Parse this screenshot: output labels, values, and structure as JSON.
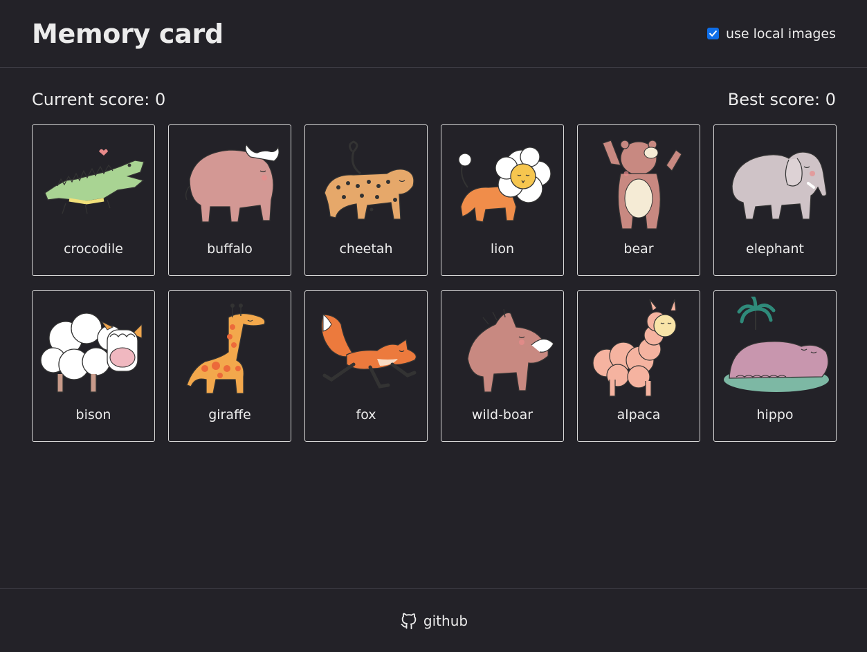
{
  "header": {
    "title": "Memory card",
    "toggle_label": "use local images",
    "toggle_checked": true
  },
  "scores": {
    "current_label": "Current score: 0",
    "best_label": "Best score: 0",
    "current": 0,
    "best": 0
  },
  "cards": [
    {
      "label": "crocodile",
      "art": "crocodile"
    },
    {
      "label": "buffalo",
      "art": "buffalo"
    },
    {
      "label": "cheetah",
      "art": "cheetah"
    },
    {
      "label": "lion",
      "art": "lion"
    },
    {
      "label": "bear",
      "art": "bear"
    },
    {
      "label": "elephant",
      "art": "elephant"
    },
    {
      "label": "bison",
      "art": "bison"
    },
    {
      "label": "giraffe",
      "art": "giraffe"
    },
    {
      "label": "fox",
      "art": "fox"
    },
    {
      "label": "wild-boar",
      "art": "wild-boar"
    },
    {
      "label": "alpaca",
      "art": "alpaca"
    },
    {
      "label": "hippo",
      "art": "hippo"
    }
  ],
  "footer": {
    "link_label": "github",
    "icon": "github-icon"
  },
  "colors": {
    "background": "#232228",
    "text": "#ececec",
    "checkbox": "#0f6ee8",
    "card_border": "#d7d7d7"
  }
}
